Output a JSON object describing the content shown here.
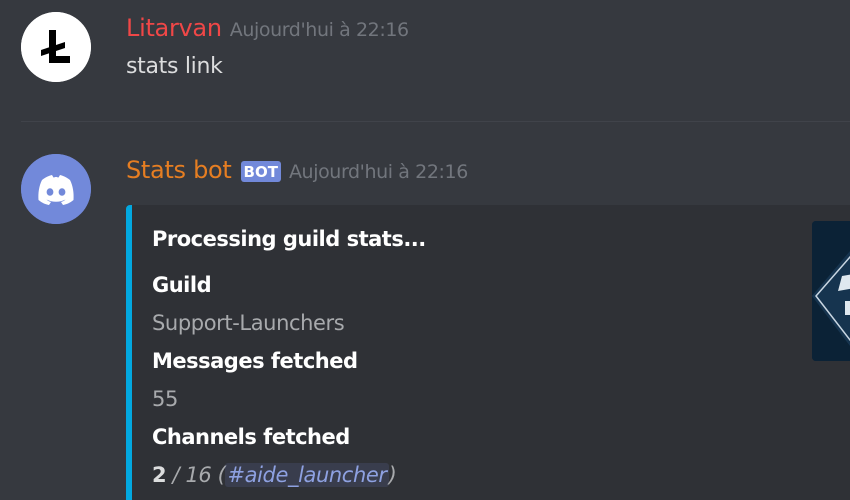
{
  "messages": [
    {
      "author": "Litarvan",
      "timestamp": "Aujourd'hui à 22:16",
      "avatar_icon": "litecoin-l-icon",
      "content": "stats link"
    },
    {
      "author": "Stats bot",
      "bot_tag": "BOT",
      "timestamp": "Aujourd'hui à 22:16",
      "avatar_icon": "discord-logo-icon",
      "embed": {
        "accent_color": "#02a8e0",
        "title": "Processing guild stats...",
        "fields": [
          {
            "name": "Guild",
            "value": "Support-Launchers"
          },
          {
            "name": "Messages fetched",
            "value": "55"
          },
          {
            "name": "Channels fetched",
            "value_bold": "2",
            "value_rest": " / 16 (",
            "channel": "#aide_launcher",
            "value_close": ")"
          }
        ]
      }
    }
  ],
  "colors": {
    "background": "#36393f",
    "litarvan": "#f04747",
    "stats_bot": "#e67e22",
    "bot_tag": "#7289da",
    "embed_bg": "#2f3136"
  }
}
